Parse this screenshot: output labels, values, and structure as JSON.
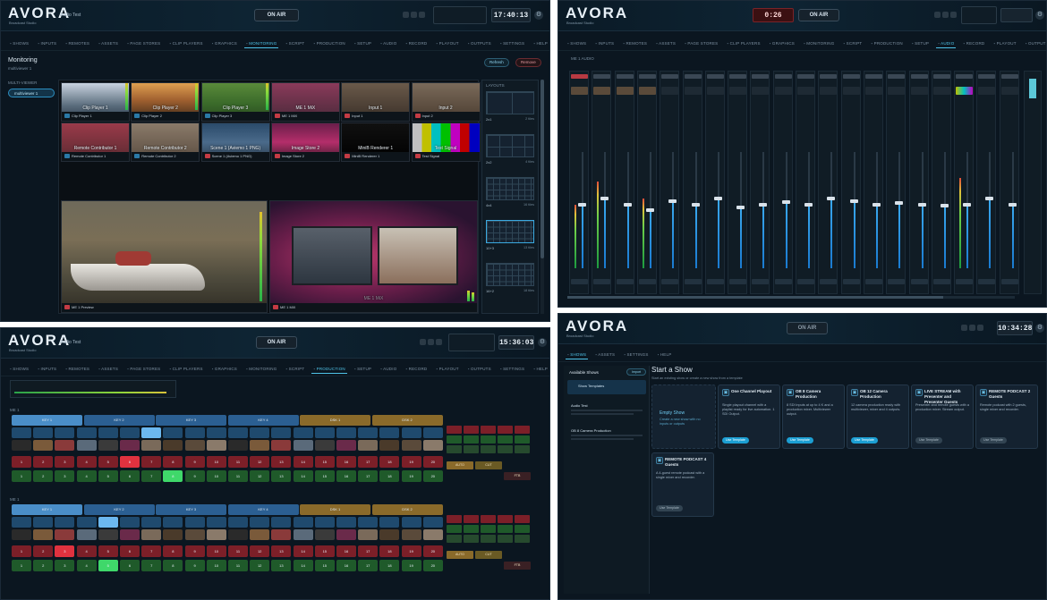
{
  "app": {
    "logo": "AVORA",
    "logo_sub": "Broadcast Studio"
  },
  "colors": {
    "accent": "#4fc3e8",
    "live_red": "#c43b44",
    "preview_green": "#2a9a45",
    "bg": "#0b1620"
  },
  "panel1": {
    "show_name": "Audio Test",
    "on_air": "ON AIR",
    "clock": "17:40:13",
    "tabs": [
      "SHOWS",
      "INPUTS",
      "REMOTES",
      "ASSETS",
      "PAGE STORES",
      "CLIP PLAYERS",
      "GRAPHICS",
      "MONITORING",
      "SCRIPT",
      "PRODUCTION",
      "SETUP",
      "AUDIO",
      "RECORD",
      "PLAYOUT",
      "OUTPUTS",
      "SETTINGS",
      "HELP"
    ],
    "active_tab": "MONITORING",
    "title": "Monitoring",
    "subtitle": "multiviewer 1",
    "multiviewer_label": "MULTI-VIEWER",
    "multiviewer_item": "multiviewer 1",
    "refresh": "Refresh",
    "remove": "Remove",
    "layouts_label": "LAYOUTS",
    "tiles": [
      {
        "label": "Clip Player 1",
        "sub": "Clip Player 1"
      },
      {
        "label": "Clip Player 2",
        "sub": "Clip Player 2"
      },
      {
        "label": "Clip Player 3",
        "sub": "Clip Player 3"
      },
      {
        "label": "ME 1 MiX",
        "sub": "ME 1 MiX"
      },
      {
        "label": "Input 1",
        "sub": "Input 1"
      },
      {
        "label": "Input 2",
        "sub": "Input 2"
      },
      {
        "label": "Remote Contributor 1",
        "sub": "Remote Contributor 1"
      },
      {
        "label": "Remote Contributor 2",
        "sub": "Remote Contributor 2"
      },
      {
        "label": "Scene 1 (Aviemo 1 PNG)",
        "sub": "Scene 1 (Aviemo 1 PNG)"
      },
      {
        "label": "Image Store 2",
        "sub": "Image Store 2"
      },
      {
        "label": "MiniB Renderer 1",
        "sub": "MiniB Renderer 1"
      },
      {
        "label": "Test Signal",
        "sub": "Test Signal"
      }
    ],
    "big_left": {
      "label": "ME 1 Preview",
      "sub": "ME 1 Preview"
    },
    "big_right": {
      "label": "ME 1 MiX",
      "sub": "ME 1 MiX"
    },
    "layouts": [
      {
        "name": "2x1",
        "size": "2 tiles"
      },
      {
        "name": "2x2",
        "size": "4 tiles"
      },
      {
        "name": "4x4",
        "size": "16 tiles"
      },
      {
        "name": "10+3",
        "size": "13 tiles"
      },
      {
        "name": "16+2",
        "size": "18 tiles"
      }
    ]
  },
  "panel2": {
    "timer": "0:26",
    "on_air": "ON AIR",
    "tabs": [
      "SHOWS",
      "INPUTS",
      "REMOTES",
      "ASSETS",
      "PAGE STORES",
      "CLIP PLAYERS",
      "GRAPHICS",
      "MONITORING",
      "SCRIPT",
      "PRODUCTION",
      "SETUP",
      "AUDIO",
      "RECORD",
      "PLAYOUT",
      "OUTPUTS",
      "SETTINGS",
      "HELP"
    ],
    "active_tab": "AUDIO",
    "mixer_label": "ME 1 AUDIO",
    "channels": 20,
    "fader_levels": [
      0.55,
      0.6,
      0.55,
      0.5,
      0.58,
      0.55,
      0.6,
      0.52,
      0.55,
      0.57,
      0.55,
      0.6,
      0.58,
      0.55,
      0.56,
      0.55,
      0.54,
      0.55,
      0.6,
      0.55
    ],
    "meter_levels": [
      0.55,
      0.75,
      0.0,
      0.6,
      0.0,
      0.0,
      0.0,
      0.0,
      0.0,
      0.0,
      0.0,
      0.0,
      0.0,
      0.0,
      0.0,
      0.0,
      0.0,
      0.78,
      0.0,
      0.0
    ]
  },
  "panel3": {
    "show_name": "Audio Test",
    "on_air": "ON AIR",
    "clock": "15:36:03",
    "tabs": [
      "SHOWS",
      "INPUTS",
      "REMOTES",
      "ASSETS",
      "PAGE STORES",
      "CLIP PLAYERS",
      "GRAPHICS",
      "MONITORING",
      "SCRIPT",
      "PRODUCTION",
      "SETUP",
      "AUDIO",
      "RECORD",
      "PLAYOUT",
      "OUTPUTS",
      "SETTINGS",
      "HELP"
    ],
    "active_tab": "PRODUCTION",
    "me1_label": "ME 1",
    "me2_label": "ME 1",
    "bus_headers": [
      "KEY 1",
      "KEY 2",
      "KEY 3",
      "KEY 4",
      "DSK 1",
      "DSK 2"
    ],
    "numbers": [
      "1",
      "2",
      "3",
      "4",
      "5",
      "6",
      "7",
      "8",
      "9",
      "10",
      "11",
      "12",
      "13",
      "14",
      "15",
      "16",
      "17",
      "18",
      "19",
      "20"
    ],
    "trans": [
      "AUTO",
      "CUT",
      "FTB"
    ]
  },
  "panel4": {
    "on_air": "ON AIR",
    "clock": "10:34:28",
    "tabs": [
      "SHOWS",
      "ASSETS",
      "SETTINGS",
      "HELP"
    ],
    "active_tab": "SHOWS",
    "sidebar_title": "Available Shows",
    "sidebar_btn": "Import",
    "sidebar_items": [
      "Show Templates",
      "Audio Test",
      "OB 8 Camera Production"
    ],
    "title": "Start a Show",
    "subtitle": "Start an existing show or create a new show from a template",
    "empty_show": {
      "title": "Empty Show",
      "desc": "Create a new show with no inputs or outputs"
    },
    "cards": [
      {
        "title": "One Channel Playout",
        "desc": "Single playout channel with a playlist ready for live automation. 1 SDI Output.",
        "btn": "Use Template"
      },
      {
        "title": "OB 8 Camera Production",
        "desc": "8 SDI inputs at up to 4 K and a production mixer. Multiviewer output.",
        "btn": "Use Template"
      },
      {
        "title": "OB 12 Camera Production",
        "desc": "12 camera production ready with multiviewer, mixer and 4 outputs.",
        "btn": "Use Template"
      },
      {
        "title": "LIVE STREAM with Presenter and Presenter Guests",
        "desc": "Presenter and remote guests with a production mixer. Stream output.",
        "btn": "Use Template"
      },
      {
        "title": "REMOTE PODCAST 2 Guests",
        "desc": "Remote podcast with 2 guests, single mixer and recorder.",
        "btn": "Use Template"
      },
      {
        "title": "REMOTE PODCAST 4 Guests",
        "desc": "A 4-guest remote podcast with a single mixer and recorder.",
        "btn": "Use Template"
      }
    ]
  }
}
